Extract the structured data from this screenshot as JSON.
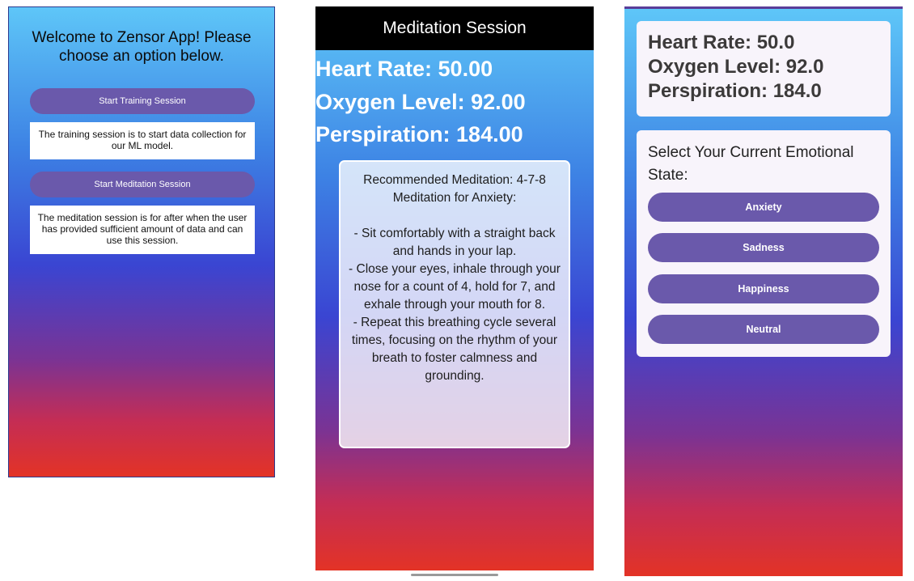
{
  "colors": {
    "button": "#6a59ab",
    "titlebar": "#000000",
    "gradient_top": "#5ec6f8",
    "gradient_mid": "#3a45d2",
    "gradient_bottom": "#e33326"
  },
  "screen1": {
    "welcome": "Welcome to Zensor App! Please choose an option below.",
    "training_button": "Start Training Session",
    "training_info": "The training session is to start data collection for our ML model.",
    "meditation_button": "Start Meditation Session",
    "meditation_info": "The meditation session is for after when the user has provided sufficient amount of data and can use this session."
  },
  "screen2": {
    "title": "Meditation Session",
    "heart_rate": "Heart Rate: 50.00",
    "oxygen": "Oxygen Level: 92.00",
    "perspiration": "Perspiration: 184.00",
    "recommendation": "Recommended Meditation: 4-7-8 Meditation for Anxiety:\n\n- Sit comfortably with a straight back and hands in your lap.\n- Close your eyes, inhale through your nose for a count of 4, hold for 7, and exhale through your mouth for 8.\n- Repeat this breathing cycle several times, focusing on the rhythm of your breath to foster calmness and grounding."
  },
  "screen3": {
    "heart_rate": "Heart Rate: 50.0",
    "oxygen": "Oxygen Level: 92.0",
    "perspiration": "Perspiration: 184.0",
    "emotion_prompt": "Select Your Current Emotional State:",
    "emotions": [
      "Anxiety",
      "Sadness",
      "Happiness",
      "Neutral"
    ]
  }
}
